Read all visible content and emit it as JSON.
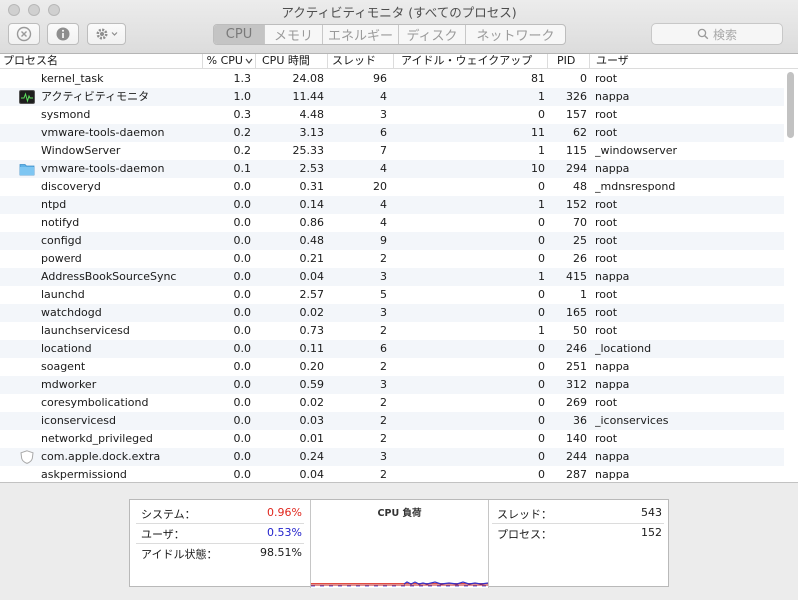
{
  "window": {
    "title": "アクティビティモニタ (すべてのプロセス)"
  },
  "toolbar": {
    "tabs": [
      "CPU",
      "メモリ",
      "エネルギー",
      "ディスク",
      "ネットワーク"
    ],
    "active_tab": "CPU",
    "search_placeholder": "検索"
  },
  "table": {
    "columns": [
      "プロセス名",
      "% CPU",
      "CPU 時間",
      "スレッド",
      "アイドル・ウェイクアップ",
      "PID",
      "ユーザ"
    ],
    "sort_column": "% CPU",
    "rows": [
      {
        "name": "kernel_task",
        "cpu": "1.3",
        "time": "24.08",
        "threads": "96",
        "idle": "81",
        "pid": "0",
        "user": "root",
        "icon": ""
      },
      {
        "name": "アクティビティモニタ",
        "cpu": "1.0",
        "time": "11.44",
        "threads": "4",
        "idle": "1",
        "pid": "326",
        "user": "nappa",
        "icon": "activity-monitor-icon"
      },
      {
        "name": "sysmond",
        "cpu": "0.3",
        "time": "4.48",
        "threads": "3",
        "idle": "0",
        "pid": "157",
        "user": "root",
        "icon": ""
      },
      {
        "name": "vmware-tools-daemon",
        "cpu": "0.2",
        "time": "3.13",
        "threads": "6",
        "idle": "11",
        "pid": "62",
        "user": "root",
        "icon": ""
      },
      {
        "name": "WindowServer",
        "cpu": "0.2",
        "time": "25.33",
        "threads": "7",
        "idle": "1",
        "pid": "115",
        "user": "_windowserver",
        "icon": ""
      },
      {
        "name": "vmware-tools-daemon",
        "cpu": "0.1",
        "time": "2.53",
        "threads": "4",
        "idle": "10",
        "pid": "294",
        "user": "nappa",
        "icon": "folder-icon"
      },
      {
        "name": "discoveryd",
        "cpu": "0.0",
        "time": "0.31",
        "threads": "20",
        "idle": "0",
        "pid": "48",
        "user": "_mdnsrespond",
        "icon": ""
      },
      {
        "name": "ntpd",
        "cpu": "0.0",
        "time": "0.14",
        "threads": "4",
        "idle": "1",
        "pid": "152",
        "user": "root",
        "icon": ""
      },
      {
        "name": "notifyd",
        "cpu": "0.0",
        "time": "0.86",
        "threads": "4",
        "idle": "0",
        "pid": "70",
        "user": "root",
        "icon": ""
      },
      {
        "name": "configd",
        "cpu": "0.0",
        "time": "0.48",
        "threads": "9",
        "idle": "0",
        "pid": "25",
        "user": "root",
        "icon": ""
      },
      {
        "name": "powerd",
        "cpu": "0.0",
        "time": "0.21",
        "threads": "2",
        "idle": "0",
        "pid": "26",
        "user": "root",
        "icon": ""
      },
      {
        "name": "AddressBookSourceSync",
        "cpu": "0.0",
        "time": "0.04",
        "threads": "3",
        "idle": "1",
        "pid": "415",
        "user": "nappa",
        "icon": ""
      },
      {
        "name": "launchd",
        "cpu": "0.0",
        "time": "2.57",
        "threads": "5",
        "idle": "0",
        "pid": "1",
        "user": "root",
        "icon": ""
      },
      {
        "name": "watchdogd",
        "cpu": "0.0",
        "time": "0.02",
        "threads": "3",
        "idle": "0",
        "pid": "165",
        "user": "root",
        "icon": ""
      },
      {
        "name": "launchservicesd",
        "cpu": "0.0",
        "time": "0.73",
        "threads": "2",
        "idle": "1",
        "pid": "50",
        "user": "root",
        "icon": ""
      },
      {
        "name": "locationd",
        "cpu": "0.0",
        "time": "0.11",
        "threads": "6",
        "idle": "0",
        "pid": "246",
        "user": "_locationd",
        "icon": ""
      },
      {
        "name": "soagent",
        "cpu": "0.0",
        "time": "0.20",
        "threads": "2",
        "idle": "0",
        "pid": "251",
        "user": "nappa",
        "icon": ""
      },
      {
        "name": "mdworker",
        "cpu": "0.0",
        "time": "0.59",
        "threads": "3",
        "idle": "0",
        "pid": "312",
        "user": "nappa",
        "icon": ""
      },
      {
        "name": "coresymbolicationd",
        "cpu": "0.0",
        "time": "0.02",
        "threads": "2",
        "idle": "0",
        "pid": "269",
        "user": "root",
        "icon": ""
      },
      {
        "name": "iconservicesd",
        "cpu": "0.0",
        "time": "0.03",
        "threads": "2",
        "idle": "0",
        "pid": "36",
        "user": "_iconservices",
        "icon": ""
      },
      {
        "name": "networkd_privileged",
        "cpu": "0.0",
        "time": "0.01",
        "threads": "2",
        "idle": "0",
        "pid": "140",
        "user": "root",
        "icon": ""
      },
      {
        "name": "com.apple.dock.extra",
        "cpu": "0.0",
        "time": "0.24",
        "threads": "3",
        "idle": "0",
        "pid": "244",
        "user": "nappa",
        "icon": "shield-icon"
      },
      {
        "name": "askpermissiond",
        "cpu": "0.0",
        "time": "0.04",
        "threads": "2",
        "idle": "0",
        "pid": "287",
        "user": "nappa",
        "icon": ""
      }
    ]
  },
  "summary": {
    "system_label": "システム：",
    "system_value": "0.96%",
    "system_color": "#e0261c",
    "user_label": "ユーザ：",
    "user_value": "0.53%",
    "user_color": "#2222cc",
    "idle_label": "アイドル状態：",
    "idle_value": "98.51%",
    "chart_title": "CPU 負荷",
    "threads_label": "スレッド：",
    "threads_value": "543",
    "processes_label": "プロセス：",
    "processes_value": "152"
  }
}
